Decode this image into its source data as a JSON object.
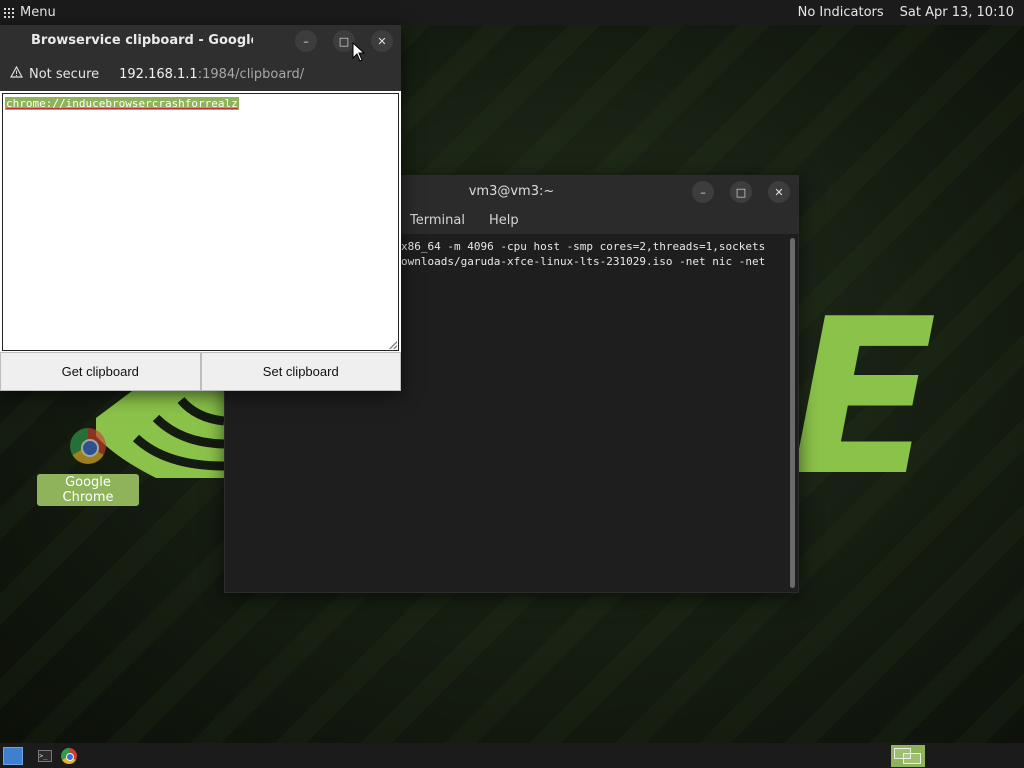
{
  "top_panel": {
    "menu_label": "Menu",
    "indicators": "No Indicators",
    "clock": "Sat Apr 13, 10:10"
  },
  "desktop": {
    "logo_letter": "E",
    "icons": [
      {
        "label": "Google Chrome"
      }
    ]
  },
  "browser_window": {
    "title": "Browservice clipboard - Google Chrome",
    "controls": {
      "minimize": "–",
      "maximize": "□",
      "close": "✕"
    },
    "address_bar": {
      "security_label": "Not secure",
      "url_host": "192.168.1.1",
      "url_rest": ":1984/clipboard/"
    },
    "clipboard_text": "chrome://inducebrowsercrashforrealz",
    "buttons": {
      "get": "Get clipboard",
      "set": "Set clipboard"
    }
  },
  "terminal_window": {
    "title": "vm3@vm3:~",
    "controls": {
      "minimize": "–",
      "maximize": "□",
      "close": "✕"
    },
    "menu": [
      "Terminal",
      "Help"
    ],
    "lines": [
      "x86_64 -m 4096 -cpu host -smp cores=2,threads=1,sockets",
      "ownloads/garuda-xfce-linux-lts-231029.iso -net nic -net"
    ]
  },
  "taskbar": {
    "items": [
      "show-desktop",
      "terminal",
      "google-chrome"
    ],
    "terminal_glyph": ">_"
  },
  "colors": {
    "accent": "#8fb35a",
    "logo_green": "#8bc34a",
    "panel": "#1b1b1b"
  }
}
